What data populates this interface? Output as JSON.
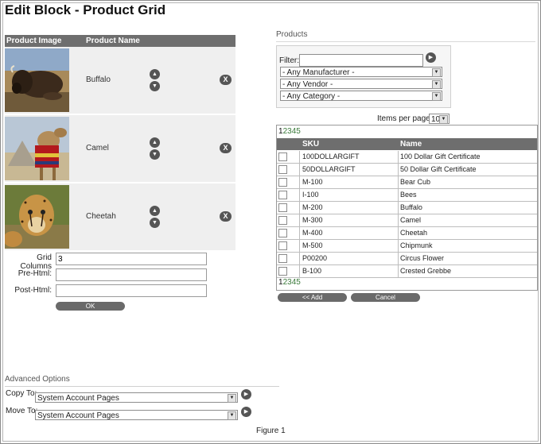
{
  "page": {
    "title": "Edit Block - Product Grid",
    "caption": "Figure 1"
  },
  "grid": {
    "col_image": "Product Image",
    "col_name": "Product Name",
    "rows": [
      {
        "name": "Buffalo"
      },
      {
        "name": "Camel"
      },
      {
        "name": "Cheetah"
      }
    ],
    "remove_glyph": "X"
  },
  "settings": {
    "grid_columns_label": "Grid Columns",
    "grid_columns_value": "3",
    "pre_html_label": "Pre-Html:",
    "pre_html_value": "",
    "post_html_label": "Post-Html:",
    "post_html_value": "",
    "ok_label": "OK"
  },
  "advanced": {
    "title": "Advanced Options",
    "copy_to_label": "Copy To:",
    "copy_to_value": "System Account Pages",
    "move_to_label": "Move To:",
    "move_to_value": "System Account Pages"
  },
  "products": {
    "title": "Products",
    "filter_label": "Filter:",
    "filter_value": "",
    "manufacturer": "- Any Manufacturer -",
    "vendor": "- Any Vendor -",
    "category": "- Any Category -",
    "items_per_page_label": "Items per page:",
    "items_per_page_value": "10",
    "pager": {
      "current": "1",
      "links": [
        "2",
        "3",
        "4",
        "5"
      ]
    },
    "columns": {
      "sku": "SKU",
      "name": "Name"
    },
    "rows": [
      {
        "sku": "100DOLLARGIFT",
        "name": "100 Dollar Gift Certificate"
      },
      {
        "sku": "50DOLLARGIFT",
        "name": "50 Dollar Gift Certificate"
      },
      {
        "sku": "M-100",
        "name": "Bear Cub"
      },
      {
        "sku": "I-100",
        "name": "Bees"
      },
      {
        "sku": "M-200",
        "name": "Buffalo"
      },
      {
        "sku": "M-300",
        "name": "Camel"
      },
      {
        "sku": "M-400",
        "name": "Cheetah"
      },
      {
        "sku": "M-500",
        "name": "Chipmunk"
      },
      {
        "sku": "P00200",
        "name": "Circus Flower"
      },
      {
        "sku": "B-100",
        "name": "Crested Grebbe"
      }
    ],
    "add_label": "<< Add",
    "cancel_label": "Cancel"
  }
}
